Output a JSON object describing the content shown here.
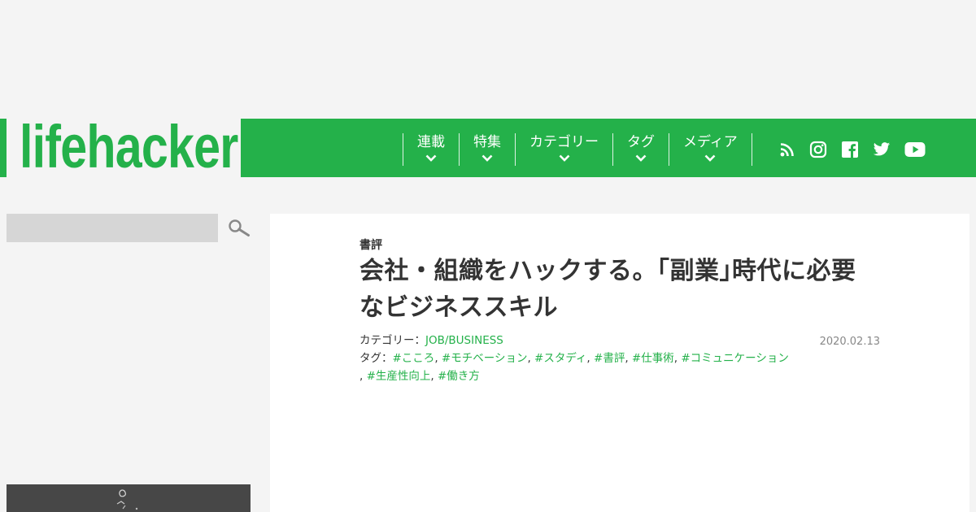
{
  "brand": {
    "logo_text": "lifehacker",
    "accent": "#24b14a"
  },
  "nav": {
    "items": [
      {
        "label": "連載"
      },
      {
        "label": "特集"
      },
      {
        "label": "カテゴリー"
      },
      {
        "label": "タグ"
      },
      {
        "label": "メディア"
      }
    ],
    "social_icons": [
      "rss-icon",
      "instagram-icon",
      "facebook-icon",
      "twitter-icon",
      "youtube-icon"
    ]
  },
  "search": {
    "placeholder": "",
    "icon": "search-icon"
  },
  "article": {
    "category": "書評",
    "title": "会社・組織をハックする。｢副業｣時代に必要なビジネススキル",
    "date": "2020.02.13",
    "category_prefix": "カテゴリー：",
    "category_link": "JOB/BUSINESS",
    "tags_prefix": "タグ：",
    "tags": [
      "#こころ",
      "#モチベーション",
      "#スタディ",
      "#書評",
      "#仕事術",
      "#コミュニケーション",
      "#生産性向上",
      "#働き方"
    ]
  }
}
